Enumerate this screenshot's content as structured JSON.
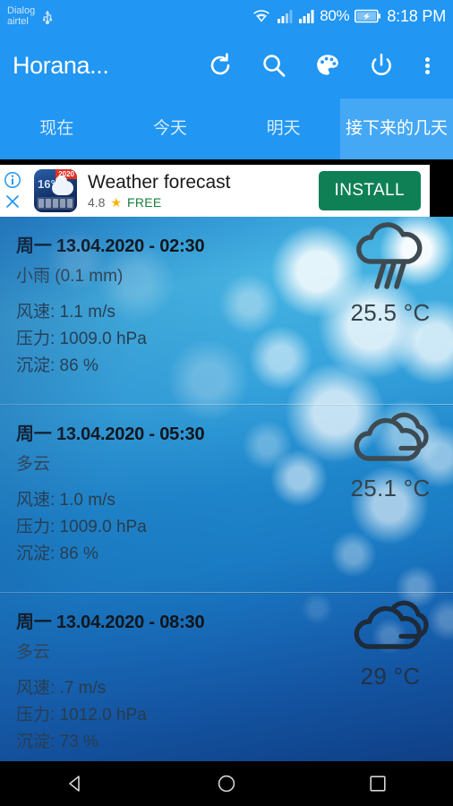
{
  "statusbar": {
    "carrier_line1": "Dialog",
    "carrier_line2": "airtel",
    "battery_percent": "80%",
    "clock": "8:18 PM"
  },
  "appbar": {
    "title": "Horana...",
    "actions": [
      {
        "name": "refresh",
        "label": "refresh-icon"
      },
      {
        "name": "search",
        "label": "search-icon"
      },
      {
        "name": "theme",
        "label": "palette-icon"
      },
      {
        "name": "power",
        "label": "power-icon"
      },
      {
        "name": "overflow",
        "label": "more-vert-icon"
      }
    ]
  },
  "tabs": [
    {
      "label": "现在",
      "selected": false
    },
    {
      "label": "今天",
      "selected": false
    },
    {
      "label": "明天",
      "selected": false
    },
    {
      "label": "接下来的几天",
      "selected": true
    }
  ],
  "ad": {
    "title": "Weather forecast",
    "rating": "4.8",
    "star": "★",
    "price": "FREE",
    "install_label": "INSTALL",
    "icon_temp": "16°C",
    "icon_year": "2020",
    "info_label": "ad-info",
    "close_label": "ad-close"
  },
  "forecast": [
    {
      "date": "周一 13.04.2020 - 02:30",
      "date_day": "周一",
      "date_rest": "13.04.2020 - 02:30",
      "description": "小雨 (0.1 mm)",
      "wind": "风速: 1.1 m/s",
      "pressure": "压力: 1009.0 hPa",
      "precipitation": "沉淀: 86 %",
      "temperature": "25.5 °C",
      "icon": "rain-cloud-icon"
    },
    {
      "date": "周一 13.04.2020 - 05:30",
      "date_day": "周一",
      "date_rest": "13.04.2020 - 05:30",
      "description": "多云",
      "wind": "风速: 1.0 m/s",
      "pressure": "压力: 1009.0 hPa",
      "precipitation": "沉淀: 86 %",
      "temperature": "25.1 °C",
      "icon": "cloudy-icon"
    },
    {
      "date": "周一 13.04.2020 - 08:30",
      "date_day": "周一",
      "date_rest": "13.04.2020 - 08:30",
      "description": "多云",
      "wind": "风速: .7 m/s",
      "pressure": "压力: 1012.0 hPa",
      "precipitation": "沉淀: 73 %",
      "temperature": "29 °C",
      "icon": "cloudy-icon"
    }
  ],
  "navbar": {
    "back": "back-icon",
    "home": "home-icon",
    "recents": "recents-icon"
  },
  "colors": {
    "primary": "#2196F3",
    "primary_selected_tab": "#45a8f5",
    "install_green": "#0f8055",
    "free_green": "#188038",
    "star_yellow": "#f5b400"
  }
}
